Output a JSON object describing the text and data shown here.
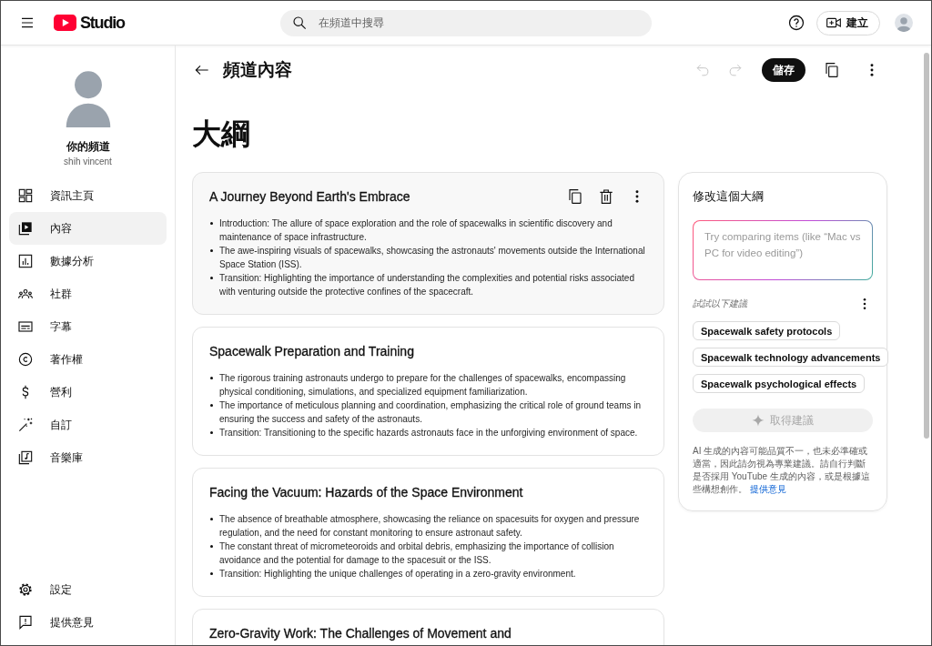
{
  "topbar": {
    "logo_text": "Studio",
    "search": {
      "placeholder": "在頻道中搜尋"
    },
    "create_button": "建立"
  },
  "sidebar": {
    "channel_title": "你的頻道",
    "channel_name": "shih vincent",
    "items": [
      {
        "label": "資訊主頁",
        "selected": false
      },
      {
        "label": "內容",
        "selected": true
      },
      {
        "label": "數據分析",
        "selected": false
      },
      {
        "label": "社群",
        "selected": false
      },
      {
        "label": "字幕",
        "selected": false
      },
      {
        "label": "著作權",
        "selected": false
      },
      {
        "label": "營利",
        "selected": false
      },
      {
        "label": "自訂",
        "selected": false
      },
      {
        "label": "音樂庫",
        "selected": false
      }
    ],
    "footer_items": [
      {
        "label": "設定"
      },
      {
        "label": "提供意見"
      }
    ]
  },
  "header": {
    "title": "頻道內容",
    "undo": {
      "disabled": true
    },
    "redo": {
      "disabled": true
    },
    "save_button": "儲存"
  },
  "outline": {
    "heading": "大綱",
    "sections": [
      {
        "title": "A Journey Beyond Earth's Embrace",
        "selected": true,
        "bullets": [
          "Introduction: The allure of space exploration and the role of spacewalks in scientific discovery and maintenance of space infrastructure.",
          "The awe-inspiring visuals of spacewalks, showcasing the astronauts' movements outside the International Space Station (ISS).",
          "Transition: Highlighting the importance of understanding the complexities and potential risks associated with venturing outside the protective confines of the spacecraft."
        ]
      },
      {
        "title": "Spacewalk Preparation and Training",
        "selected": false,
        "bullets": [
          "The rigorous training astronauts undergo to prepare for the challenges of spacewalks, encompassing physical conditioning, simulations, and specialized equipment familiarization.",
          "The importance of meticulous planning and coordination, emphasizing the critical role of ground teams in ensuring the success and safety of the astronauts.",
          "Transition: Transitioning to the specific hazards astronauts face in the unforgiving environment of space."
        ]
      },
      {
        "title": "Facing the Vacuum: Hazards of the Space Environment",
        "selected": false,
        "bullets": [
          "The absence of breathable atmosphere, showcasing the reliance on spacesuits for oxygen and pressure regulation, and the need for constant monitoring to ensure astronaut safety.",
          "The constant threat of micrometeoroids and orbital debris, emphasizing the importance of collision avoidance and the potential for damage to the spacesuit or the ISS.",
          "Transition: Highlighting the unique challenges of operating in a zero-gravity environment."
        ]
      },
      {
        "title": "Zero-Gravity Work: The Challenges of Movement and",
        "selected": false
      }
    ]
  },
  "panel": {
    "title": "修改這個大綱",
    "prompt": {
      "placeholder": "Try comparing items (like “Mac vs PC for video editing”)"
    },
    "suggestions_label": "試試以下建議",
    "suggestions": [
      "Spacewalk safety protocols",
      "Spacewalk technology advancements",
      "Spacewalk psychological effects"
    ],
    "get_button": {
      "label": "取得建議",
      "disabled": true
    },
    "disclaimer": "AI 生成的內容可能品質不一，也未必準確或適當，因此請勿視為專業建議。請自行判斷是否採用 YouTube 生成的內容，或是根據這些構想創作。",
    "disclaimer_link": "提供意見"
  }
}
